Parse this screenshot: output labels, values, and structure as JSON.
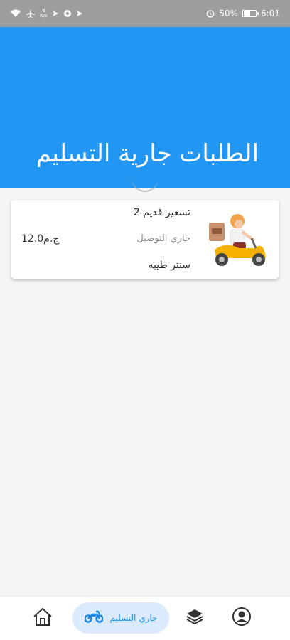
{
  "status_bar": {
    "speed_value": "8",
    "speed_unit": "K/s",
    "battery": "50%",
    "time": "6:01"
  },
  "header": {
    "title": "الطلبات جارية التسليم"
  },
  "orders": [
    {
      "title": "تسعير قديم 2",
      "status": "جاري التوصيل",
      "price": "12.0ج.م",
      "merchant": "سنتر طيبه"
    }
  ],
  "bottom_nav": {
    "active_label": "جاري التسليم",
    "active_color": "#2196f3",
    "items": [
      "home-icon",
      "motorcycle-icon",
      "layers-icon",
      "profile-icon"
    ]
  },
  "colors": {
    "header": "#2196f3",
    "status_bar": "#9e9e9e",
    "background": "#f5f5f5"
  }
}
